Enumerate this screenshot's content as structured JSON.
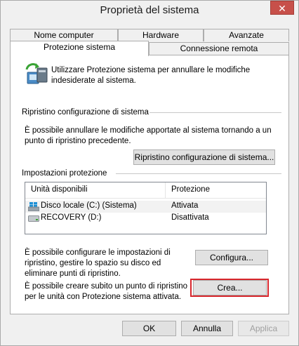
{
  "window": {
    "title": "Proprietà del sistema",
    "close_glyph": "✕"
  },
  "tabs_row1": [
    {
      "label": "Nome computer"
    },
    {
      "label": "Hardware"
    },
    {
      "label": "Avanzate"
    }
  ],
  "tabs_row2": [
    {
      "label": "Protezione sistema"
    },
    {
      "label": "Connessione remota"
    }
  ],
  "intro": {
    "text": "Utilizzare Protezione sistema per annullare le modifiche indesiderate al sistema."
  },
  "restore": {
    "section_title": "Ripristino configurazione di sistema",
    "description": "È possibile annullare le modifiche apportate al sistema tornando a un punto di ripristino precedente.",
    "button_label": "Ripristino configurazione di sistema..."
  },
  "protection": {
    "section_title": "Impostazioni protezione",
    "columns": [
      "Unità disponibili",
      "Protezione"
    ],
    "drives": [
      {
        "name": "Disco locale (C:) (Sistema)",
        "status": "Attivata",
        "icon": "windows-drive-icon"
      },
      {
        "name": "RECOVERY (D:)",
        "status": "Disattivata",
        "icon": "drive-icon"
      }
    ],
    "configure_text": "È possibile configurare le impostazioni di ripristino, gestire lo spazio su disco ed eliminare punti di ripristino.",
    "configure_button": "Configura...",
    "create_text": "È possibile creare subito un punto di ripristino per le unità con Protezione sistema attivata.",
    "create_button": "Crea..."
  },
  "footer": {
    "ok": "OK",
    "cancel": "Annulla",
    "apply": "Applica"
  }
}
